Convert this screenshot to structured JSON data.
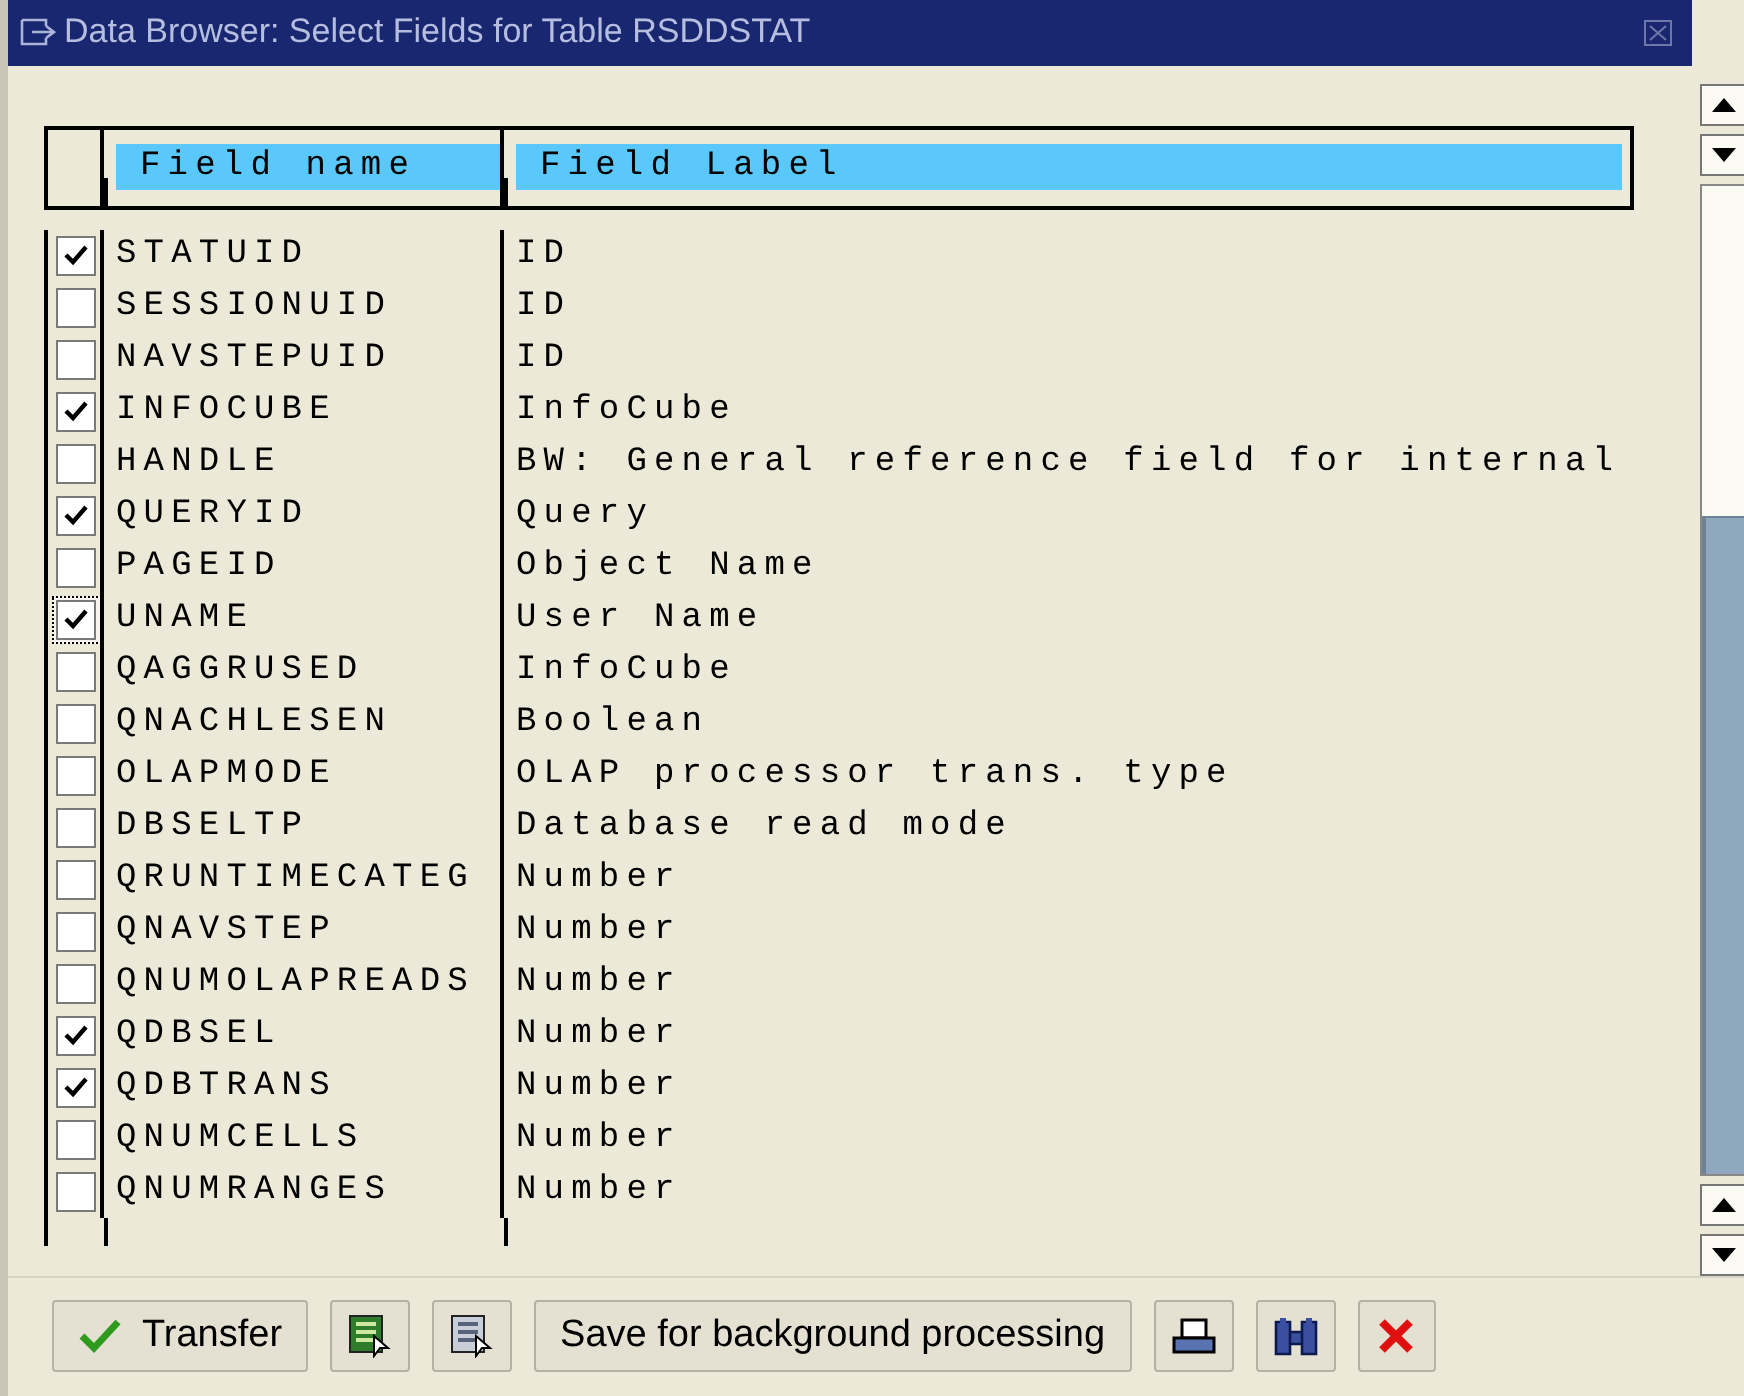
{
  "window": {
    "title": "Data Browser: Select Fields for Table RSDDSTAT"
  },
  "table": {
    "columns": [
      "Field name",
      "Field Label"
    ],
    "rows": [
      {
        "checked": true,
        "focused": false,
        "field": "STATUID",
        "label": "ID"
      },
      {
        "checked": false,
        "focused": false,
        "field": "SESSIONUID",
        "label": "ID"
      },
      {
        "checked": false,
        "focused": false,
        "field": "NAVSTEPUID",
        "label": "ID"
      },
      {
        "checked": true,
        "focused": false,
        "field": "INFOCUBE",
        "label": "InfoCube"
      },
      {
        "checked": false,
        "focused": false,
        "field": "HANDLE",
        "label": "BW: General reference field for internal"
      },
      {
        "checked": true,
        "focused": false,
        "field": "QUERYID",
        "label": "Query"
      },
      {
        "checked": false,
        "focused": false,
        "field": "PAGEID",
        "label": "Object Name"
      },
      {
        "checked": true,
        "focused": true,
        "field": "UNAME",
        "label": "User Name"
      },
      {
        "checked": false,
        "focused": false,
        "field": "QAGGRUSED",
        "label": "InfoCube"
      },
      {
        "checked": false,
        "focused": false,
        "field": "QNACHLESEN",
        "label": "Boolean"
      },
      {
        "checked": false,
        "focused": false,
        "field": "OLAPMODE",
        "label": "OLAP processor trans. type"
      },
      {
        "checked": false,
        "focused": false,
        "field": "DBSELTP",
        "label": "Database read mode"
      },
      {
        "checked": false,
        "focused": false,
        "field": "QRUNTIMECATEG",
        "label": "Number"
      },
      {
        "checked": false,
        "focused": false,
        "field": "QNAVSTEP",
        "label": "Number"
      },
      {
        "checked": false,
        "focused": false,
        "field": "QNUMOLAPREADS",
        "label": "Number"
      },
      {
        "checked": true,
        "focused": false,
        "field": "QDBSEL",
        "label": "Number"
      },
      {
        "checked": true,
        "focused": false,
        "field": "QDBTRANS",
        "label": "Number"
      },
      {
        "checked": false,
        "focused": false,
        "field": "QNUMCELLS",
        "label": "Number"
      },
      {
        "checked": false,
        "focused": false,
        "field": "QNUMRANGES",
        "label": "Number"
      }
    ]
  },
  "toolbar": [
    {
      "kind": "transfer",
      "label": "Transfer"
    },
    {
      "kind": "select-all"
    },
    {
      "kind": "deselect-all"
    },
    {
      "kind": "text",
      "label": "Save for background processing"
    },
    {
      "kind": "print"
    },
    {
      "kind": "find"
    },
    {
      "kind": "cancel"
    }
  ]
}
